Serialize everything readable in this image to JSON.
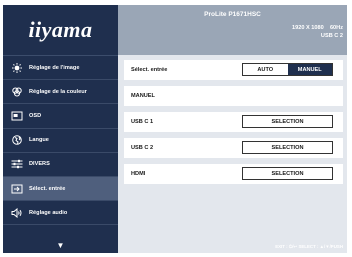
{
  "brand": {
    "logo_text": "iiyama"
  },
  "header": {
    "model": "ProLite P1671HSC",
    "resolution": "1920 X 1080",
    "refresh": "60Hz",
    "current_input": "USB C 2"
  },
  "sidebar": {
    "items": [
      {
        "label": "Réglage de l'image",
        "icon": "brightness-icon"
      },
      {
        "label": "Réglage de la couleur",
        "icon": "color-palette-icon"
      },
      {
        "label": "OSD",
        "icon": "osd-icon"
      },
      {
        "label": "Langue",
        "icon": "globe-icon"
      },
      {
        "label": "DIVERS",
        "icon": "settings-sliders-icon"
      },
      {
        "label": "Sélect. entrée",
        "icon": "input-select-icon",
        "active": true
      },
      {
        "label": "Réglage audio",
        "icon": "speaker-icon"
      }
    ],
    "scroll_arrow": "▼"
  },
  "settings": {
    "input_select": {
      "label": "Sélect. entrée",
      "options": [
        "AUTO",
        "MANUEL"
      ],
      "selected": "MANUEL"
    },
    "manual_label": "MANUEL",
    "inputs": [
      {
        "label": "USB C 1",
        "button": "SELECTION"
      },
      {
        "label": "USB C 2",
        "button": "SELECTION"
      },
      {
        "label": "HDMI",
        "button": "SELECTION"
      }
    ]
  },
  "footer": {
    "hint": "EXIT : ⏻/↩  SELECT : ▲/▼/PUSH"
  }
}
